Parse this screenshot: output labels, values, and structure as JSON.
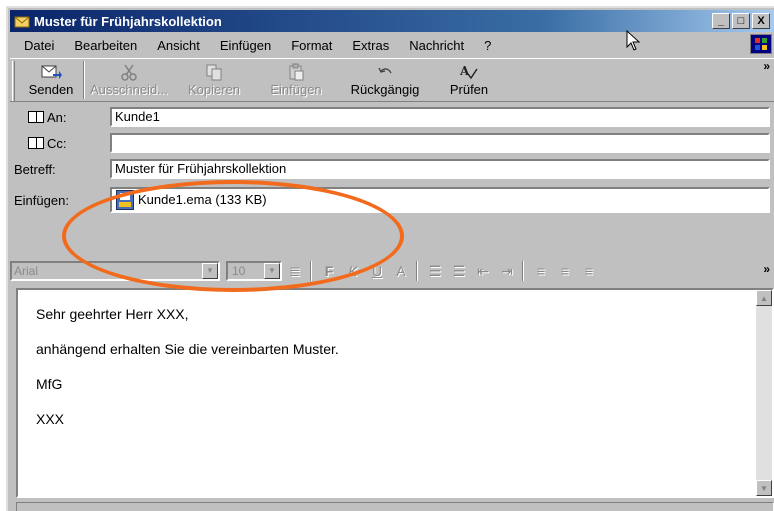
{
  "window": {
    "title": "Muster für Frühjahrskollektion",
    "controls": [
      "_",
      "□",
      "X"
    ]
  },
  "menu": [
    {
      "label": "Datei"
    },
    {
      "label": "Bearbeiten"
    },
    {
      "label": "Ansicht"
    },
    {
      "label": "Einfügen"
    },
    {
      "label": "Format"
    },
    {
      "label": "Extras"
    },
    {
      "label": "Nachricht"
    },
    {
      "label": "?"
    }
  ],
  "toolbar": {
    "send": "Senden",
    "cut": "Ausschneid...",
    "copy": "Kopieren",
    "paste": "Einfügen",
    "undo": "Rückgängig",
    "check": "Prüfen",
    "more": "»"
  },
  "headers": {
    "to_label": "An:",
    "to_value": "Kunde1",
    "cc_label": "Cc:",
    "cc_value": "",
    "subject_label": "Betreff:",
    "subject_value": "Muster für Frühjahrskollektion",
    "attach_label": "Einfügen:",
    "attach_value": "Kunde1.ema (133 KB)"
  },
  "format": {
    "font": "Arial",
    "size": "10",
    "more": "»"
  },
  "body": {
    "line1": "Sehr geehrter Herr XXX,",
    "line2": "anhängend erhalten Sie die vereinbarten Muster.",
    "line3": "MfG",
    "line4": "XXX"
  },
  "colors": {
    "highlight": "#f26b1d",
    "titlebar": "#0a246a"
  }
}
